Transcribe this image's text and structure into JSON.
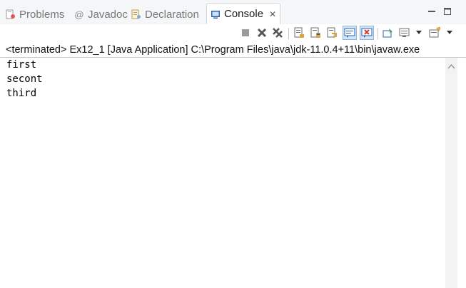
{
  "tabs": [
    {
      "label": "Problems",
      "icon": "problems-icon",
      "active": false
    },
    {
      "label": "Javadoc",
      "icon": "javadoc-icon",
      "active": false
    },
    {
      "label": "Declaration",
      "icon": "declaration-icon",
      "active": false
    },
    {
      "label": "Console",
      "icon": "console-icon",
      "active": true
    }
  ],
  "tab_close_glyph": "✕",
  "javadoc_glyph": "@",
  "window_controls": {
    "minimize": "minimize-icon",
    "maximize": "maximize-icon"
  },
  "toolbar": {
    "icons": [
      "terminate-icon",
      "remove-launch-icon",
      "remove-all-terminated-icon",
      "clear-console-icon",
      "scroll-lock-icon",
      "word-wrap-icon",
      "show-on-stdout-icon",
      "show-on-stderr-icon",
      "pin-console-icon",
      "display-selected-console-icon",
      "open-console-icon"
    ]
  },
  "process_line": "<terminated> Ex12_1 [Java Application] C:\\Program Files\\java\\jdk-11.0.4+11\\bin\\javaw.exe",
  "console_output": [
    "first",
    "secont",
    "third"
  ],
  "colors": {
    "tab_bar_bg": "#f5f6f7",
    "console_icon_blue": "#2a64b3",
    "pressed_bg": "#d4e5f5",
    "terminate_gray": "#9a9a9a"
  }
}
